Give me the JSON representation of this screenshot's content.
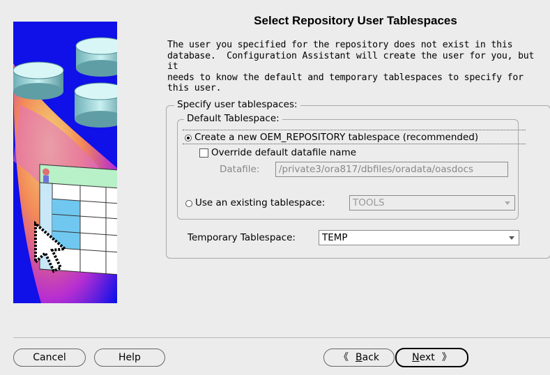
{
  "title": "Select Repository User Tablespaces",
  "description": "The user you specified for the repository does not exist in this\ndatabase.  Configuration Assistant will create the user for you, but it\nneeds to know the default and temporary tablespaces to specify for\nthis user.",
  "specify_group": {
    "legend": "Specify user tablespaces:",
    "default_group": {
      "legend": "Default Tablespace:",
      "create_radio_label": "Create a new OEM_REPOSITORY tablespace (recommended)",
      "override_checkbox_label": "Override default datafile name",
      "datafile_label": "Datafile:",
      "datafile_value": "/private3/ora817/dbfiles/oradata/oasdocs",
      "existing_radio_label": "Use an existing tablespace:",
      "existing_value": "TOOLS"
    },
    "temporary_label": "Temporary Tablespace:",
    "temporary_value": "TEMP"
  },
  "buttons": {
    "cancel": "Cancel",
    "help": "Help",
    "back_prefix": "B",
    "back_rest": "ack",
    "next_prefix": "N",
    "next_rest": "ext"
  },
  "colors": {
    "illustration_bg": "#1010e8",
    "dialog_bg": "#ececec"
  }
}
